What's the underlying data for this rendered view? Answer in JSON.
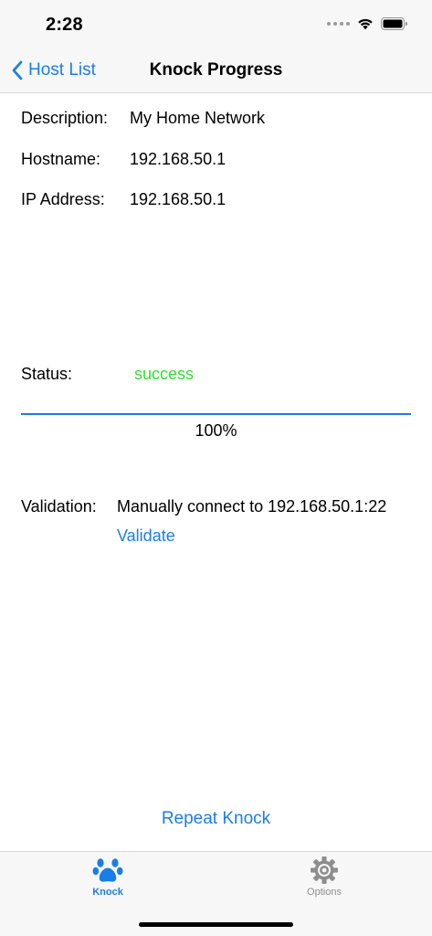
{
  "status_bar": {
    "time": "2:28"
  },
  "nav": {
    "back_label": "Host List",
    "title": "Knock Progress"
  },
  "details": {
    "description_label": "Description:",
    "description_value": "My Home Network",
    "hostname_label": "Hostname:",
    "hostname_value": "192.168.50.1",
    "ip_label": "IP Address:",
    "ip_value": "192.168.50.1"
  },
  "status": {
    "label": "Status:",
    "value": "success",
    "progress_percent": 100,
    "progress_text": "100%"
  },
  "validation": {
    "label": "Validation:",
    "value": "Manually connect to 192.168.50.1:22",
    "link_label": "Validate"
  },
  "actions": {
    "repeat_label": "Repeat Knock"
  },
  "tab_bar": {
    "tabs": [
      {
        "label": "Knock",
        "icon": "paw-icon",
        "selected": true
      },
      {
        "label": "Options",
        "icon": "gear-icon",
        "selected": false
      }
    ]
  },
  "colors": {
    "accent": "#1a7ee6",
    "success": "#2ee02e",
    "inactive": "#8e8e8e"
  }
}
